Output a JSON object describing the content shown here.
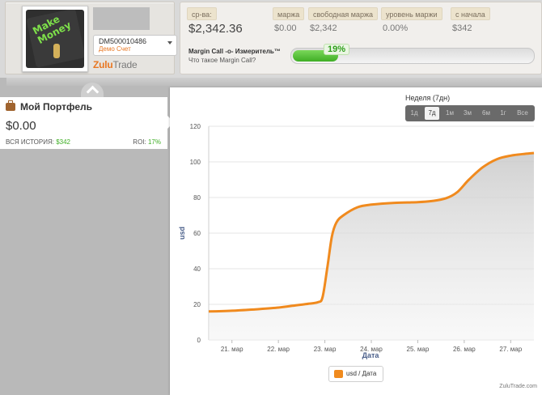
{
  "account": {
    "id": "DM500010486",
    "type": "Демо Счет",
    "logo_main": "Zulu",
    "logo_rest": "Trade",
    "avatar_text_1": "Make",
    "avatar_text_2": "Money"
  },
  "metrics": [
    {
      "label": "ср-ва:",
      "value": "$2,342.36"
    },
    {
      "label": "маржа",
      "value": "$0.00"
    },
    {
      "label": "свободная маржа",
      "value": "$2,342"
    },
    {
      "label": "уровень маржи",
      "value": "0.00%"
    },
    {
      "label": "с начала",
      "value": "$342"
    }
  ],
  "margin_call": {
    "title": "Margin Call -o- Измеритель™",
    "subtitle": "Что такое Margin Call?",
    "percent_label": "19%",
    "level": 0.19
  },
  "portfolio": {
    "title": "Мой Портфель",
    "value": "$0.00",
    "history_label": "ВСЯ ИСТОРИЯ:",
    "history_value": "$342",
    "roi_label": "ROI:",
    "roi_value": "17%"
  },
  "range": {
    "title": "Неделя (7дн)",
    "buttons": [
      "1д",
      "7д",
      "1м",
      "3м",
      "6м",
      "1г",
      "Все"
    ],
    "active": "7д"
  },
  "footer_credit": "ZuluTrade.com",
  "colors": {
    "accent": "#e87722",
    "positive": "#3fae25",
    "series_line": "#f08a1e"
  },
  "chart_data": {
    "type": "area",
    "title": "",
    "xlabel": "Дата",
    "ylabel": "usd",
    "ylim": [
      0,
      120
    ],
    "yticks": [
      0,
      20,
      40,
      60,
      80,
      100,
      120
    ],
    "categories": [
      "21. мар",
      "22. мар",
      "23. мар",
      "24. мар",
      "25. мар",
      "26. мар",
      "27. мар"
    ],
    "legend": "usd / Дата",
    "legend_position": "bottom-center",
    "grid": true,
    "series": [
      {
        "name": "usd / Дата",
        "x": [
          20.5,
          21.0,
          21.5,
          22.0,
          22.3,
          22.6,
          22.85,
          22.95,
          23.05,
          23.15,
          23.25,
          23.4,
          23.7,
          24.0,
          24.5,
          25.0,
          25.3,
          25.6,
          25.85,
          26.1,
          26.4,
          26.7,
          27.0,
          27.3,
          27.5
        ],
        "y": [
          16,
          16.4,
          17.2,
          18.2,
          19.2,
          20.2,
          21.2,
          24,
          40,
          58,
          66,
          70,
          74.5,
          76,
          77,
          77.4,
          78,
          79.5,
          83,
          90,
          97,
          101.5,
          103.5,
          104.5,
          105
        ]
      }
    ]
  }
}
